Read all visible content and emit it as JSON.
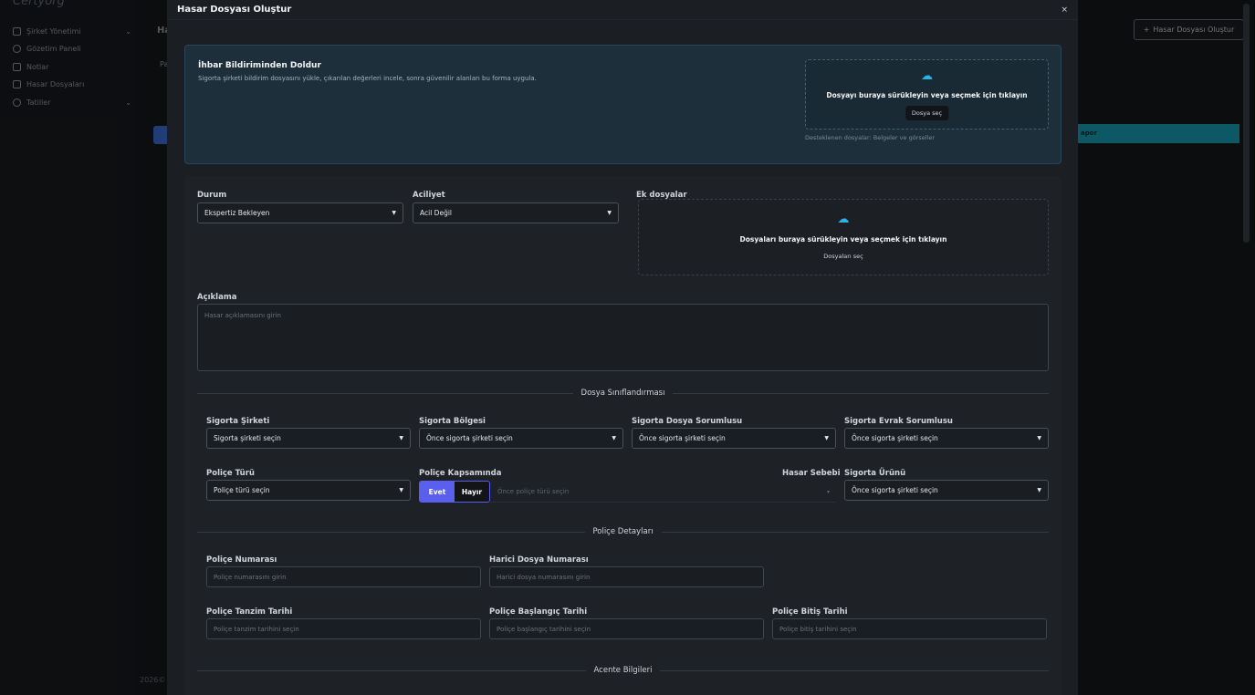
{
  "background": {
    "logo": "Certyorg",
    "sidebar": [
      {
        "label": "Şirket Yönetimi",
        "chevron": true
      },
      {
        "label": "Gözetim Paneli",
        "chevron": false
      },
      {
        "label": "Notlar",
        "chevron": false
      },
      {
        "label": "Hasar Dosyaları",
        "chevron": false
      },
      {
        "label": "Tatiller",
        "chevron": true
      }
    ],
    "header_partial": "Ha",
    "sub_partial": "Pa",
    "create_button": "Hasar Dosyası Oluştur",
    "teal_partial": "apor",
    "footer": "2026©"
  },
  "modal": {
    "title": "Hasar Dosyası Oluştur",
    "close": "×",
    "notice": {
      "title": "İhbar Bildiriminden Doldur",
      "description": "Sigorta şirketi bildirim dosyasını yükle, çıkarılan değerleri incele, sonra güvenilir alanları bu forma uygula.",
      "drop_text": "Dosyayı buraya sürükleyin veya seçmek için tıklayın",
      "drop_button": "Dosya seç",
      "supported": "Desteklenen dosyalar: Belgeler ve görseller"
    },
    "form": {
      "status_label": "Durum",
      "status_value": "Ekspertiz Bekleyen",
      "urgency_label": "Aciliyet",
      "urgency_value": "Acil Değil",
      "attachments_label": "Ek dosyalar",
      "attachments_drop_text": "Dosyaları buraya sürükleyin veya seçmek için tıklayın",
      "attachments_button": "Dosyaları seç",
      "description_label": "Açıklama",
      "description_placeholder": "Hasar açıklamasını girin",
      "section_classification": "Dosya Sınıflandırması",
      "insurer_label": "Sigorta Şirketi",
      "insurer_value": "Sigorta şirketi seçin",
      "region_label": "Sigorta Bölgesi",
      "region_value": "Önce sigorta şirketi seçin",
      "file_owner_label": "Sigorta Dosya Sorumlusu",
      "file_owner_value": "Önce sigorta şirketi seçin",
      "doc_owner_label": "Sigorta Evrak Sorumlusu",
      "doc_owner_value": "Önce sigorta şirketi seçin",
      "policy_type_label": "Poliçe Türü",
      "policy_type_value": "Poliçe türü seçin",
      "coverage_label": "Poliçe Kapsamında",
      "coverage_yes": "Evet",
      "coverage_no": "Hayır",
      "cause_label": "Hasar Sebebi",
      "cause_placeholder": "Önce poliçe türü seçin",
      "product_label": "Sigorta Ürünü",
      "product_value": "Önce sigorta şirketi seçin",
      "section_policy": "Poliçe Detayları",
      "policy_no_label": "Poliçe Numarası",
      "policy_no_placeholder": "Poliçe numarasını girin",
      "ext_no_label": "Harici Dosya Numarası",
      "ext_no_placeholder": "Harici dosya numarasını girin",
      "issue_date_label": "Poliçe Tanzim Tarihi",
      "issue_date_placeholder": "Poliçe tanzim tarihini seçin",
      "start_date_label": "Poliçe Başlangıç Tarihi",
      "start_date_placeholder": "Poliçe başlangıç tarihini seçin",
      "end_date_label": "Poliçe Bitiş Tarihi",
      "end_date_placeholder": "Poliçe bitiş tarihini seçin",
      "section_agency": "Acente Bilgileri"
    }
  }
}
